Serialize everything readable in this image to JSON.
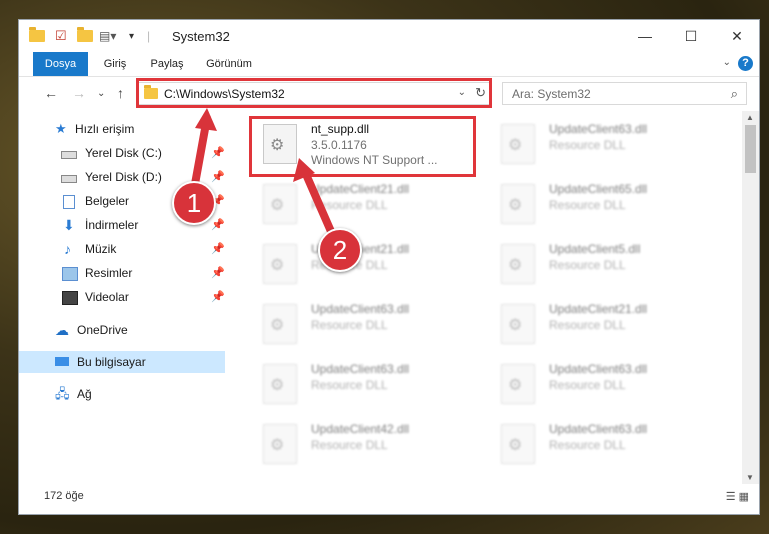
{
  "window": {
    "title": "System32",
    "controls": {
      "minimize": "—",
      "maximize": "☐",
      "close": "✕"
    }
  },
  "ribbon": {
    "tabs": [
      "Dosya",
      "Giriş",
      "Paylaş",
      "Görünüm"
    ],
    "help": "?"
  },
  "address": {
    "path": "C:\\Windows\\System32",
    "search_placeholder": "Ara: System32"
  },
  "nav": {
    "quick_access": "Hızlı erişim",
    "items": [
      {
        "label": "Yerel Disk (C:)",
        "icon": "drive-icon"
      },
      {
        "label": "Yerel Disk (D:)",
        "icon": "drive-icon"
      },
      {
        "label": "Belgeler",
        "icon": "document-icon"
      },
      {
        "label": "İndirmeler",
        "icon": "download-icon"
      },
      {
        "label": "Müzik",
        "icon": "music-icon"
      },
      {
        "label": "Resimler",
        "icon": "pictures-icon"
      },
      {
        "label": "Videolar",
        "icon": "video-icon"
      }
    ],
    "onedrive": "OneDrive",
    "this_pc": "Bu bilgisayar",
    "network": "Ağ"
  },
  "files": {
    "highlighted": {
      "name": "nt_supp.dll",
      "version": "3.5.0.1176",
      "description": "Windows NT Support ..."
    },
    "left_column": [
      {
        "name": "UpdateClient21.dll",
        "type": "Resource DLL"
      },
      {
        "name": "UpdateClient21.dll",
        "type": "Resource DLL"
      },
      {
        "name": "UpdateClient63.dll",
        "type": "Resource DLL"
      },
      {
        "name": "UpdateClient63.dll",
        "type": "Resource DLL"
      },
      {
        "name": "UpdateClient42.dll",
        "type": "Resource DLL"
      }
    ],
    "right_column": [
      {
        "name": "UpdateClient63.dll",
        "type": "Resource DLL"
      },
      {
        "name": "UpdateClient65.dll",
        "type": "Resource DLL"
      },
      {
        "name": "UpdateClient5.dll",
        "type": "Resource DLL"
      },
      {
        "name": "UpdateClient21.dll",
        "type": "Resource DLL"
      },
      {
        "name": "UpdateClient63.dll",
        "type": "Resource DLL"
      },
      {
        "name": "UpdateClient63.dll",
        "type": "Resource DLL"
      }
    ]
  },
  "status": {
    "count": "172 öğe"
  },
  "annotations": {
    "step1": "1",
    "step2": "2",
    "color": "#e0353a"
  }
}
